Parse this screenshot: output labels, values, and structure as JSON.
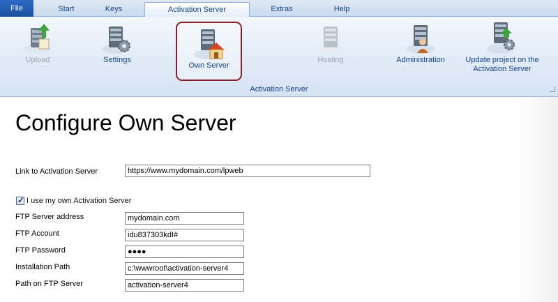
{
  "tabs": [
    {
      "label": "File"
    },
    {
      "label": "Start"
    },
    {
      "label": "Keys"
    },
    {
      "label": "Activation Server"
    },
    {
      "label": "Extras"
    },
    {
      "label": "Help"
    }
  ],
  "active_tab": "Activation Server",
  "ribbon": {
    "group_label": "Activation Server",
    "buttons": [
      {
        "label": "Upload",
        "icon": "upload-server-icon",
        "enabled": false
      },
      {
        "label": "Settings",
        "icon": "server-settings-icon",
        "enabled": true
      },
      {
        "label": "Own Server",
        "icon": "own-server-house-icon",
        "enabled": true,
        "selected": true
      },
      {
        "label": "Hosting",
        "icon": "hosting-server-icon",
        "enabled": false
      },
      {
        "label": "Administration",
        "icon": "administration-server-icon",
        "enabled": true
      },
      {
        "label_line1": "Update project on the",
        "label_line2": "Activation Server",
        "icon": "update-server-icon",
        "enabled": true
      }
    ]
  },
  "page": {
    "title": "Configure Own Server",
    "link_label": "Link to Activation Server",
    "link_value": "https://www.mydomain.com/lpweb",
    "checkbox_label": "I use my own Activation Server",
    "checkbox_checked": true,
    "fields": [
      {
        "label": "FTP Server address",
        "value": "mydomain.com"
      },
      {
        "label": "FTP Account",
        "value": "idu837303kdI#"
      },
      {
        "label": "FTP Password",
        "value": "●●●●"
      },
      {
        "label": "Installation Path",
        "value": "c:\\wwwroot\\activation-server4"
      },
      {
        "label": "Path on FTP Server",
        "value": "activation-server4"
      }
    ]
  },
  "colors": {
    "accent": "#15428b",
    "selected_border": "#8a1f24",
    "file_tab": "#1b4fa0"
  }
}
